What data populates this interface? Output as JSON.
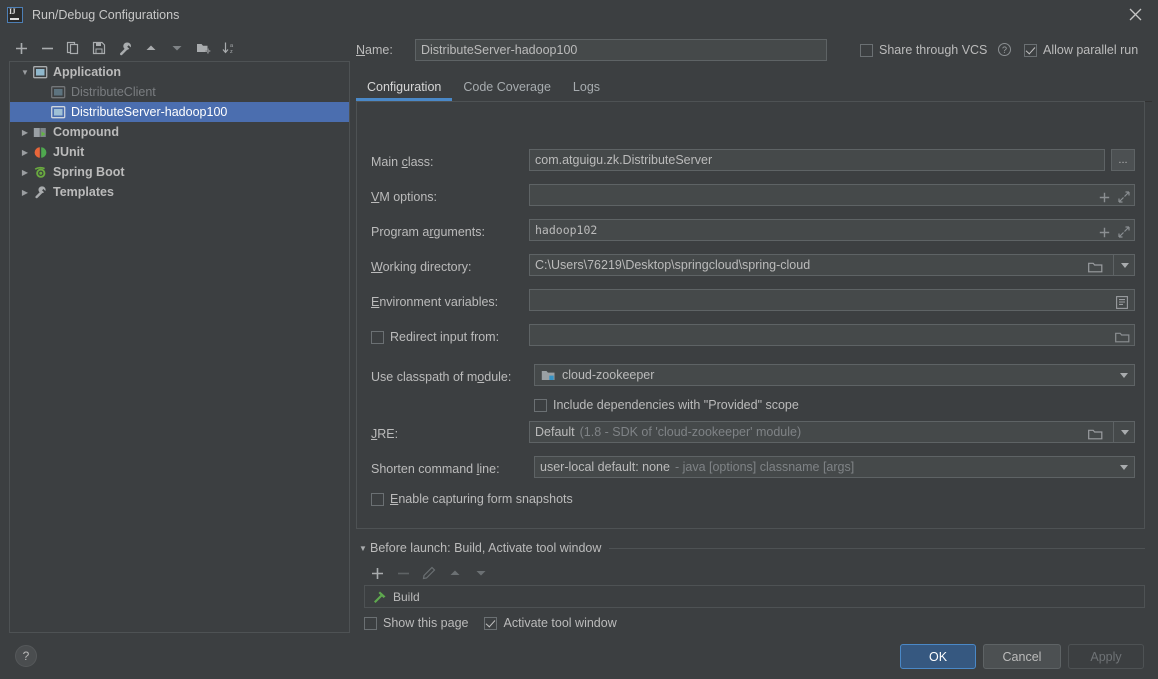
{
  "window": {
    "title": "Run/Debug Configurations",
    "logo_icon": "intellij-idea-icon",
    "close_icon": "close-icon"
  },
  "toolbar": {
    "items": [
      {
        "name": "add-configuration-button",
        "icon": "plus-icon",
        "glyph": "+"
      },
      {
        "name": "remove-configuration-button",
        "icon": "minus-icon",
        "glyph": "−"
      },
      {
        "name": "copy-configuration-button",
        "icon": "copy-icon",
        "glyph": "copy"
      },
      {
        "name": "save-configuration-button",
        "icon": "save-icon",
        "glyph": "save"
      },
      {
        "name": "edit-templates-button",
        "icon": "wrench-icon",
        "glyph": "wrench"
      },
      {
        "name": "move-up-button",
        "icon": "arrow-up-icon",
        "glyph": "up"
      },
      {
        "name": "move-down-button",
        "icon": "arrow-down-icon",
        "glyph": "down"
      },
      {
        "name": "move-into-folder-button",
        "icon": "folder-add-icon",
        "glyph": "folder"
      },
      {
        "name": "sort-configurations-button",
        "icon": "sort-alpha-icon",
        "glyph": "sort"
      }
    ]
  },
  "tree": {
    "nodes": [
      {
        "label": "Application",
        "icon": "application-icon",
        "expanded": true,
        "group": true,
        "depth": 0,
        "selected": false,
        "dim": false
      },
      {
        "label": "DistributeClient",
        "icon": "application-icon",
        "expanded": null,
        "group": false,
        "depth": 1,
        "selected": false,
        "dim": true
      },
      {
        "label": "DistributeServer-hadoop100",
        "icon": "application-icon",
        "expanded": null,
        "group": false,
        "depth": 1,
        "selected": true,
        "dim": false
      },
      {
        "label": "Compound",
        "icon": "compound-icon",
        "expanded": false,
        "group": true,
        "depth": 0,
        "selected": false,
        "dim": false
      },
      {
        "label": "JUnit",
        "icon": "junit-icon",
        "expanded": false,
        "group": true,
        "depth": 0,
        "selected": false,
        "dim": false
      },
      {
        "label": "Spring Boot",
        "icon": "spring-boot-icon",
        "expanded": false,
        "group": true,
        "depth": 0,
        "selected": false,
        "dim": false
      },
      {
        "label": "Templates",
        "icon": "wrench-icon",
        "expanded": false,
        "group": true,
        "depth": 0,
        "selected": false,
        "dim": false
      }
    ]
  },
  "header": {
    "name_label": "Name:",
    "name_value": "DistributeServer-hadoop100",
    "share_vcs_label": "Share through VCS",
    "share_vcs_checked": false,
    "help_icon": "question-circle-icon",
    "allow_parallel_label": "Allow parallel run",
    "allow_parallel_checked": true
  },
  "tabs": [
    {
      "label": "Configuration",
      "active": true
    },
    {
      "label": "Code Coverage",
      "active": false
    },
    {
      "label": "Logs",
      "active": false
    }
  ],
  "form": {
    "main_class_label": "Main class:",
    "main_class_value": "com.atguigu.zk.DistributeServer",
    "main_class_browse": "...",
    "vm_options_label": "VM options:",
    "vm_options_value": "",
    "program_arguments_label": "Program arguments:",
    "program_arguments_value": "hadoop102",
    "working_directory_label": "Working directory:",
    "working_directory_value": "C:\\Users\\76219\\Desktop\\springcloud\\spring-cloud",
    "environment_variables_label": "Environment variables:",
    "environment_variables_value": "",
    "redirect_input_label": "Redirect input from:",
    "redirect_input_checked": false,
    "redirect_input_value": "",
    "classpath_module_label": "Use classpath of module:",
    "classpath_module_value": "cloud-zookeeper",
    "classpath_module_icon": "module-icon",
    "include_provided_label": "Include dependencies with \"Provided\" scope",
    "include_provided_checked": false,
    "jre_label": "JRE:",
    "jre_value": "Default",
    "jre_hint": "(1.8 - SDK of 'cloud-zookeeper' module)",
    "shorten_cmd_label": "Shorten command line:",
    "shorten_cmd_value": "user-local default: none",
    "shorten_cmd_hint": "- java [options] classname [args]",
    "form_snapshots_label": "Enable capturing form snapshots",
    "form_snapshots_checked": false
  },
  "before_launch": {
    "header": "Before launch: Build, Activate tool window",
    "toolbar": [
      {
        "name": "add-task-button",
        "icon": "plus-icon",
        "glyph": "+",
        "disabled": false
      },
      {
        "name": "remove-task-button",
        "icon": "minus-icon",
        "glyph": "−",
        "disabled": true
      },
      {
        "name": "edit-task-button",
        "icon": "pencil-icon",
        "glyph": "pencil",
        "disabled": true
      },
      {
        "name": "move-task-up-button",
        "icon": "arrow-up-icon",
        "glyph": "up",
        "disabled": true
      },
      {
        "name": "move-task-down-button",
        "icon": "arrow-down-icon",
        "glyph": "down",
        "disabled": true
      }
    ],
    "tasks": [
      {
        "label": "Build",
        "icon": "build-hammer-icon"
      }
    ],
    "show_page_label": "Show this page",
    "show_page_checked": false,
    "activate_tool_window_label": "Activate tool window",
    "activate_tool_window_checked": true
  },
  "footer": {
    "help_label": "?",
    "ok_label": "OK",
    "cancel_label": "Cancel",
    "apply_label": "Apply",
    "apply_disabled": true
  },
  "colors": {
    "background": "#3c3f41",
    "selection": "#4b6eaf",
    "accent": "#4a88c7",
    "field": "#45494a",
    "border": "#4e5254",
    "primary_button": "#365880"
  }
}
